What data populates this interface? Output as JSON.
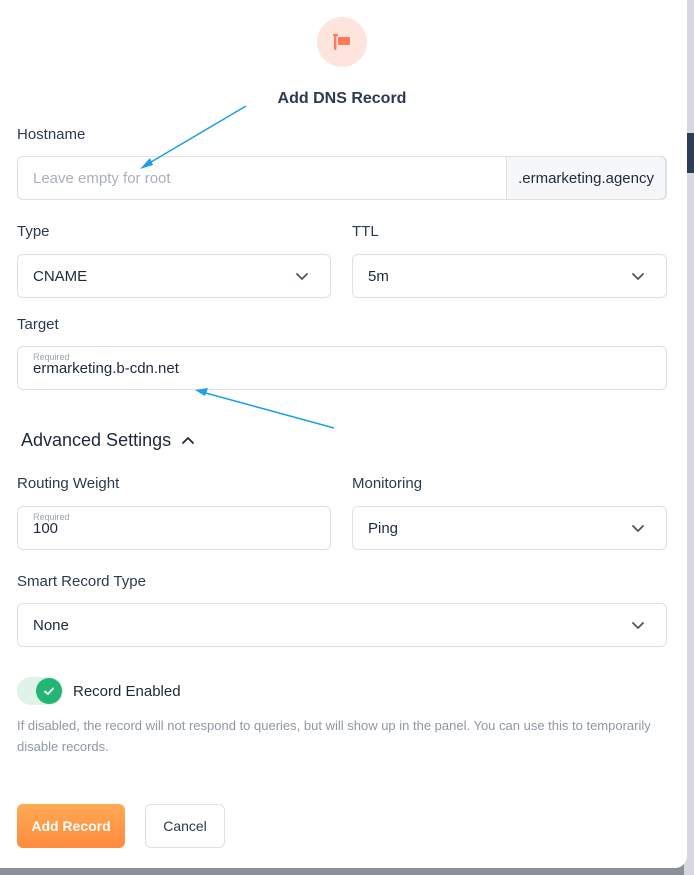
{
  "dialog": {
    "title": "Add DNS Record",
    "icon": "flag-icon",
    "accent_color": "#ff7a59"
  },
  "hostname": {
    "label": "Hostname",
    "placeholder": "Leave empty for root",
    "value": "",
    "suffix": ".ermarketing.agency"
  },
  "type": {
    "label": "Type",
    "value": "CNAME"
  },
  "ttl": {
    "label": "TTL",
    "value": "5m"
  },
  "target": {
    "label": "Target",
    "required_hint": "Required",
    "value": "ermarketing.b-cdn.net"
  },
  "advanced": {
    "label": "Advanced Settings",
    "expanded": true
  },
  "routing_weight": {
    "label": "Routing Weight",
    "required_hint": "Required",
    "value": "100"
  },
  "monitoring": {
    "label": "Monitoring",
    "value": "Ping"
  },
  "smart_record_type": {
    "label": "Smart Record Type",
    "value": "None"
  },
  "record_enabled": {
    "label": "Record Enabled",
    "enabled": true,
    "help": "If disabled, the record will not respond to queries, but will show up in the panel. You can use this to temporarily disable records."
  },
  "actions": {
    "add_label": "Add Record",
    "cancel_label": "Cancel"
  },
  "colors": {
    "primary_button": "#ff8a3d",
    "toggle_on": "#22b573",
    "annotation_arrow": "#1ea0e6"
  }
}
